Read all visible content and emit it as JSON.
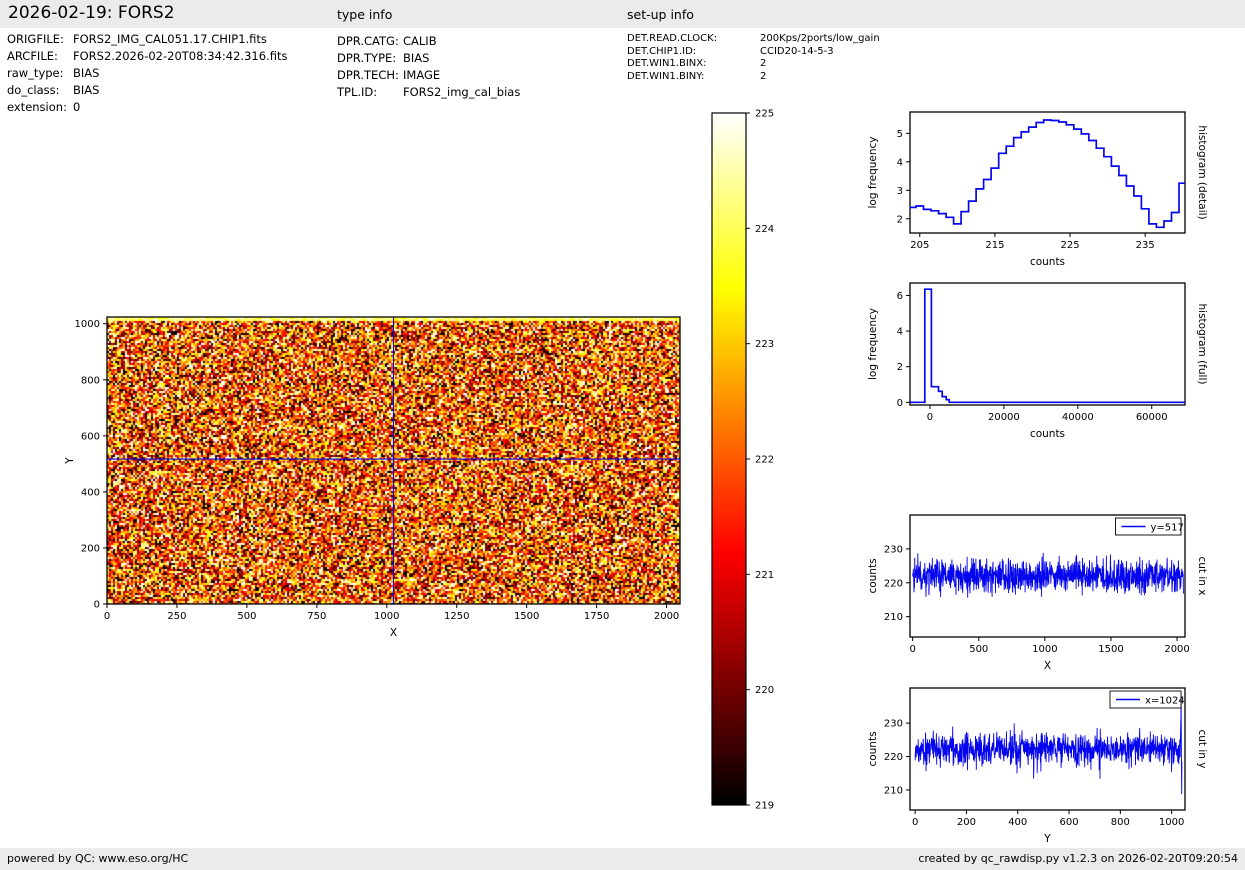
{
  "header": {
    "title": "2026-02-19: FORS2",
    "type_info_label": "type info",
    "setup_info_label": "set-up info"
  },
  "file_info": {
    "rows": [
      {
        "label": "ORIGFILE:",
        "value": "FORS2_IMG_CAL051.17.CHIP1.fits"
      },
      {
        "label": "ARCFILE:",
        "value": "FORS2.2026-02-20T08:34:42.316.fits"
      },
      {
        "label": "raw_type:",
        "value": "BIAS"
      },
      {
        "label": "do_class:",
        "value": "BIAS"
      },
      {
        "label": "extension:",
        "value": "0"
      }
    ]
  },
  "type_info": {
    "rows": [
      {
        "label": "DPR.CATG:",
        "value": "CALIB"
      },
      {
        "label": "DPR.TYPE:",
        "value": "BIAS"
      },
      {
        "label": "DPR.TECH:",
        "value": "IMAGE"
      },
      {
        "label": "TPL.ID:",
        "value": "FORS2_img_cal_bias"
      }
    ]
  },
  "setup_info": {
    "rows": [
      {
        "label": "DET.READ.CLOCK:",
        "value": "200Kps/2ports/low_gain"
      },
      {
        "label": "DET.CHIP1.ID:",
        "value": "CCID20-14-5-3"
      },
      {
        "label": "DET.WIN1.BINX:",
        "value": "2"
      },
      {
        "label": "DET.WIN1.BINY:",
        "value": "2"
      }
    ]
  },
  "footer": {
    "left": "powered by QC: www.eso.org/HC",
    "right": "created by qc_rawdisp.py v1.2.3 on 2026-02-20T09:20:54"
  },
  "colors": {
    "accent_line": "#0606ee",
    "panel_bg": "#ebebeb",
    "frame": "#000000"
  },
  "chart_data": [
    {
      "id": "main_image",
      "type": "heatmap",
      "xlabel": "X",
      "ylabel": "Y",
      "xlim": [
        0,
        2048
      ],
      "ylim": [
        0,
        1024
      ],
      "xticks": [
        0,
        250,
        500,
        750,
        1000,
        1250,
        1500,
        1750,
        2000
      ],
      "yticks": [
        0,
        200,
        400,
        600,
        800,
        1000
      ],
      "colormap": "hot",
      "noise_mean": 222,
      "noise_sigma": 2.0,
      "crosshair_x": 1024,
      "crosshair_y": 517,
      "colorbar": {
        "vmin": 219,
        "vmax": 225,
        "ticks": [
          219,
          220,
          221,
          222,
          223,
          224,
          225
        ]
      }
    },
    {
      "id": "histogram_detail",
      "type": "line",
      "style": "step",
      "right_label": "histogram (detail)",
      "xlabel": "counts",
      "ylabel": "log frequency",
      "xlim": [
        203.7,
        240.3
      ],
      "ylim": [
        1.5,
        5.75
      ],
      "xticks": [
        205,
        215,
        225,
        235
      ],
      "yticks": [
        2,
        3,
        4,
        5
      ],
      "bin_start": 204,
      "bin_width": 1,
      "values": [
        2.4,
        2.45,
        2.33,
        2.28,
        2.18,
        2.05,
        1.82,
        2.25,
        2.62,
        3.05,
        3.38,
        3.78,
        4.3,
        4.55,
        4.85,
        5.05,
        5.22,
        5.38,
        5.47,
        5.45,
        5.4,
        5.3,
        5.15,
        4.98,
        4.75,
        4.48,
        4.18,
        3.85,
        3.52,
        3.15,
        2.8,
        2.35,
        1.82,
        1.7,
        1.92,
        2.22,
        3.25
      ]
    },
    {
      "id": "histogram_full",
      "type": "line",
      "style": "step",
      "right_label": "histogram (full)",
      "xlabel": "counts",
      "ylabel": "log frequency",
      "xlim": [
        -5400,
        69000
      ],
      "ylim": [
        -0.15,
        6.7
      ],
      "xticks": [
        0,
        20000,
        40000,
        60000
      ],
      "yticks": [
        0,
        2,
        4,
        6
      ],
      "step_edges": [
        -5400,
        -1400,
        400,
        2300,
        3300,
        4400,
        5200,
        69000
      ],
      "step_values": [
        0,
        6.35,
        0.88,
        0.62,
        0.32,
        0.15,
        0
      ]
    },
    {
      "id": "cut_in_x",
      "type": "line",
      "legend": "y=517",
      "right_label": "cut in x",
      "xlabel": "X",
      "ylabel": "counts",
      "xlim": [
        -20,
        2060
      ],
      "ylim": [
        204,
        240
      ],
      "xticks": [
        0,
        500,
        1000,
        1500,
        2000
      ],
      "yticks": [
        210,
        220,
        230
      ],
      "x_data_max": 2048,
      "n_points": 1200,
      "mean": 222,
      "sigma": 2.4,
      "clip_min": 213.6,
      "clip_max": 231.2,
      "seed": 1717
    },
    {
      "id": "cut_in_y",
      "type": "line",
      "legend": "x=1024",
      "right_label": "cut in y",
      "xlabel": "Y",
      "ylabel": "counts",
      "xlim": [
        -20,
        1052
      ],
      "ylim": [
        204,
        240.5
      ],
      "xticks": [
        0,
        200,
        400,
        600,
        800,
        1000
      ],
      "yticks": [
        210,
        220,
        230
      ],
      "x_data_max": 1040,
      "n_points": 1030,
      "mean": 222.3,
      "sigma": 2.4,
      "clip_min": 211.2,
      "clip_max": 232.4,
      "seed": 9091,
      "end_anomaly": [
        228,
        231.5,
        238.6,
        221,
        208.7,
        218.5
      ]
    }
  ]
}
